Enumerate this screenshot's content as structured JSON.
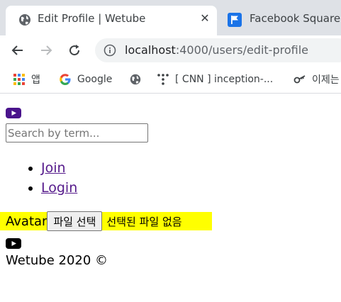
{
  "browser": {
    "tabs": [
      {
        "title": "Edit Profile | Wetube",
        "active": true,
        "icon": "globe-icon"
      },
      {
        "title": "Facebook Square Ic",
        "active": false,
        "icon": "flag-icon"
      }
    ],
    "address_bar": {
      "host": "localhost",
      "path": ":4000/users/edit-profile"
    },
    "bookmarks": [
      {
        "label": "앱",
        "icon": "apps-grid-icon"
      },
      {
        "label": "Google",
        "icon": "google-g-icon"
      },
      {
        "label": "",
        "icon": "globe-icon"
      },
      {
        "label": "[ CNN ] inception-...",
        "icon": "dots-icon"
      },
      {
        "label": "이제는",
        "icon": "key-icon"
      }
    ],
    "colors": {
      "tabstrip": "#dee1e6",
      "omnibox": "#f1f3f4"
    }
  },
  "page": {
    "header_logo": "youtube-icon",
    "search": {
      "placeholder": "Search by term..."
    },
    "nav": [
      {
        "label": "Join"
      },
      {
        "label": "Login"
      }
    ],
    "avatar_field": {
      "label": "Avatar",
      "button_label": "파일 선택",
      "status": "선택된 파일 없음",
      "highlight_color": "#ffff00"
    },
    "footer": {
      "logo": "youtube-icon",
      "text": "Wetube 2020 ©"
    },
    "colors": {
      "logo_purple": "#4a148c",
      "link": "#551a8b"
    }
  }
}
